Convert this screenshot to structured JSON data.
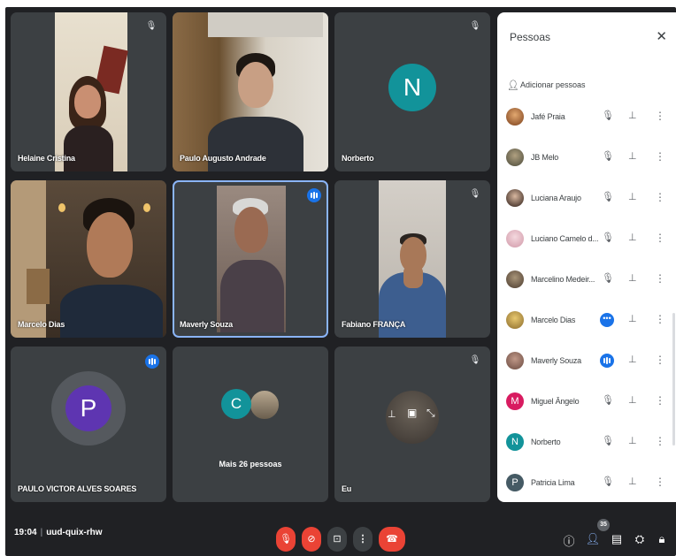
{
  "tiles": [
    {
      "name": "Helaine Cristina",
      "status": "muted"
    },
    {
      "name": "Paulo Augusto Andrade",
      "status": "none"
    },
    {
      "name": "Norberto",
      "initial": "N",
      "avatar_color": "#12939a",
      "status": "muted"
    },
    {
      "name": "Marcelo Dias",
      "status": "none"
    },
    {
      "name": "Maverly Souza",
      "status": "speaking"
    },
    {
      "name": "Fabiano FRANÇA",
      "status": "muted"
    },
    {
      "name": "PAULO VICTOR ALVES SOARES",
      "initial": "P",
      "avatar_color": "#5e35b1",
      "status": "speaking"
    },
    {
      "name": "",
      "initial": "C",
      "avatar_color": "#12939a",
      "caption": "Mais 26 pessoas"
    },
    {
      "name": "Eu",
      "status": "muted"
    }
  ],
  "panel": {
    "title": "Pessoas",
    "close_icon": "close-icon",
    "add_label": "Adicionar pessoas",
    "people": [
      {
        "name": "Jafé Praia",
        "state": "muted",
        "avatar_color": "#b5651d"
      },
      {
        "name": "JB Melo",
        "state": "muted",
        "avatar_color": "#6d7a5a"
      },
      {
        "name": "Luciana Araujo",
        "state": "muted",
        "avatar_color": "#4a3b33"
      },
      {
        "name": "Luciano Camelo d...",
        "state": "muted",
        "avatar_color": "#e3b5c0"
      },
      {
        "name": "Marcelino Medeir...",
        "state": "muted",
        "avatar_color": "#7a6d5e"
      },
      {
        "name": "Marcelo Dias",
        "state": "more",
        "avatar_color": "#c4a35a"
      },
      {
        "name": "Maverly Souza",
        "state": "speaking",
        "avatar_color": "#a07870"
      },
      {
        "name": "Miguel Ângelo",
        "state": "muted",
        "initial": "M",
        "avatar_color": "#d81b60"
      },
      {
        "name": "Norberto",
        "state": "muted",
        "initial": "N",
        "avatar_color": "#12939a"
      },
      {
        "name": "Patricia Lima",
        "state": "muted",
        "initial": "P",
        "avatar_color": "#455a64"
      }
    ]
  },
  "bottom_bar": {
    "time": "19:04",
    "meeting_code": "uud-quix-rhw",
    "people_count": "35"
  },
  "colors": {
    "background": "#202124",
    "tile": "#3c4043",
    "accent": "#1a73e8",
    "danger": "#ea4335"
  }
}
